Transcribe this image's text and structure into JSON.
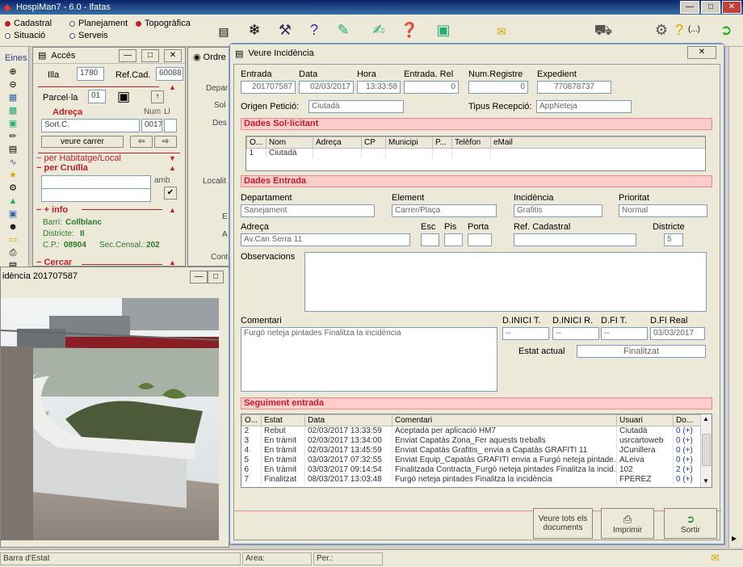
{
  "app": {
    "title": "HospiMan7  -  6.0 - lfatas"
  },
  "toolbar": {
    "radios": [
      {
        "label": "Cadastral",
        "selected": true
      },
      {
        "label": "Planejament",
        "selected": false
      },
      {
        "label": "Topogràfica",
        "selected": true
      },
      {
        "label": "Situació",
        "selected": false
      },
      {
        "label": "Serveis",
        "selected": false
      }
    ],
    "trailing_text": "(...)"
  },
  "eines": {
    "label": "Eines"
  },
  "acces": {
    "title": "Accés",
    "illa_label": "Illa",
    "illa_value": "1780",
    "refcad_label": "Ref.Cad.",
    "refcad_value": "60088",
    "parcela_label": "Parcel·la",
    "parcela_value": "01",
    "adreca_label": "Adreça",
    "num_label": "Num",
    "ll_label": "Ll",
    "street_value": "Sort.C.",
    "num_value": "0017",
    "veure_carrer": "veure carrer",
    "per_habitatge": "per Habitatge/Local",
    "per_cruilla": "per Cruïlla",
    "amb_label": "amb",
    "info_label": "+ info",
    "barri_label": "Barri:",
    "barri_value": "Collblanc",
    "districte_label": "Districte:",
    "districte_value": "II",
    "cp_label": "C.P.:",
    "cp_value": "08904",
    "seccensal_label": "Sec.Censal.:",
    "seccensal_value": "202",
    "cercar_label": "Cercar"
  },
  "ordre": {
    "title": "Ordre",
    "labels": [
      "Depar",
      "Sol",
      "Des",
      "Localit",
      "E",
      "A",
      "Contr"
    ]
  },
  "photo": {
    "title": "idència 201707587"
  },
  "dialog": {
    "title": "Veure Incidència",
    "entrada_label": "Entrada",
    "entrada_value": "201707587",
    "data_label": "Data",
    "data_value": "02/03/2017",
    "hora_label": "Hora",
    "hora_value": "13:33:58",
    "entrada_rel_label": "Entrada. Rel",
    "entrada_rel_value": "0",
    "num_registre_label": "Num.Registre",
    "num_registre_value": "0",
    "expedient_label": "Expedient",
    "expedient_value": "770878737",
    "origen_label": "Origen Petició:",
    "origen_value": "Ciutadà",
    "tipus_label": "Tipus Recepció:",
    "tipus_value": "AppNeteja",
    "sol_section": "Dades Sol·licitant",
    "sol_columns": [
      "O...",
      "Nom",
      "Adreça",
      "CP",
      "Municipi",
      "P...",
      "Telèfon",
      "eMail"
    ],
    "sol_rows": [
      [
        "1",
        "Ciutadà",
        "",
        "",
        "",
        "",
        "",
        ""
      ]
    ],
    "entrada_section": "Dades Entrada",
    "departament_label": "Departament",
    "departament_value": "Sanejament",
    "element_label": "Element",
    "element_value": "Carrer/Plaça",
    "incidencia_label": "Incidència",
    "incidencia_value": "Grafitis",
    "prioritat_label": "Prioritat",
    "prioritat_value": "Normal",
    "adreca_label": "Adreça",
    "adreca_value": "Av.Can Serra 11",
    "esc_label": "Esc",
    "pis_label": "Pis",
    "porta_label": "Porta",
    "refcad_label": "Ref. Cadastral",
    "districte_label": "Districte",
    "districte_value": "5",
    "observacions_label": "Observacions",
    "comentari_label": "Comentari",
    "comentari_value": "Furgó neteja pintades Finalitza la incidència",
    "dinici_t_label": "D.INICI T.",
    "dinici_t_value": "--",
    "dinici_r_label": "D.INICI R.",
    "dinici_r_value": "--",
    "dfi_t_label": "D.FI T.",
    "dfi_t_value": "--",
    "dfi_real_label": "D.FI Real",
    "dfi_real_value": "03/03/2017",
    "estat_label": "Estat actual",
    "estat_value": "Finalitzat",
    "seg_section": "Seguiment entrada",
    "seg_columns": [
      "O...",
      "Estat",
      "Data",
      "Comentari",
      "Usuari",
      "Do..."
    ],
    "seg_rows": [
      [
        "2",
        "Rebut",
        "02/03/2017 13:33:59",
        "Aceptada per aplicació HM7",
        "Ciutadà",
        "0 (+)"
      ],
      [
        "3",
        "En tràmit",
        "02/03/2017 13:34:00",
        "Enviat Capatàs Zona_Fer aquests treballs",
        "usrcartoweb",
        "0 (+)"
      ],
      [
        "4",
        "En tràmit",
        "02/03/2017 13:45:59",
        "Enviat Capatàs Grafitis_ envia a Capatàs GRAFITI 11",
        "JCunillera",
        "0 (+)"
      ],
      [
        "5",
        "En tràmit",
        "03/03/2017 07:32:55",
        "Enviat Equip_Capatàs GRAFITI envia a Furgó neteja pintade...",
        "ALeiva",
        "0 (+)"
      ],
      [
        "6",
        "En tràmit",
        "03/03/2017 09:14:54",
        "Finalitzada Contracta_Furgó neteja pintades Finalitza la incid...",
        "102",
        "2 (+)"
      ],
      [
        "7",
        "Finalitzat",
        "08/03/2017 13:03:48",
        "Furgó neteja pintades Finalitza la incidència",
        "FPEREZ",
        "0 (+)"
      ]
    ],
    "btn_veure_tots": "Veure tots els documents",
    "btn_imprimir": "Imprimir",
    "btn_sortir": "Sortir"
  },
  "statusbar": {
    "barra": "Barra d'Estat",
    "area": "Area:",
    "per": "Per.:"
  }
}
